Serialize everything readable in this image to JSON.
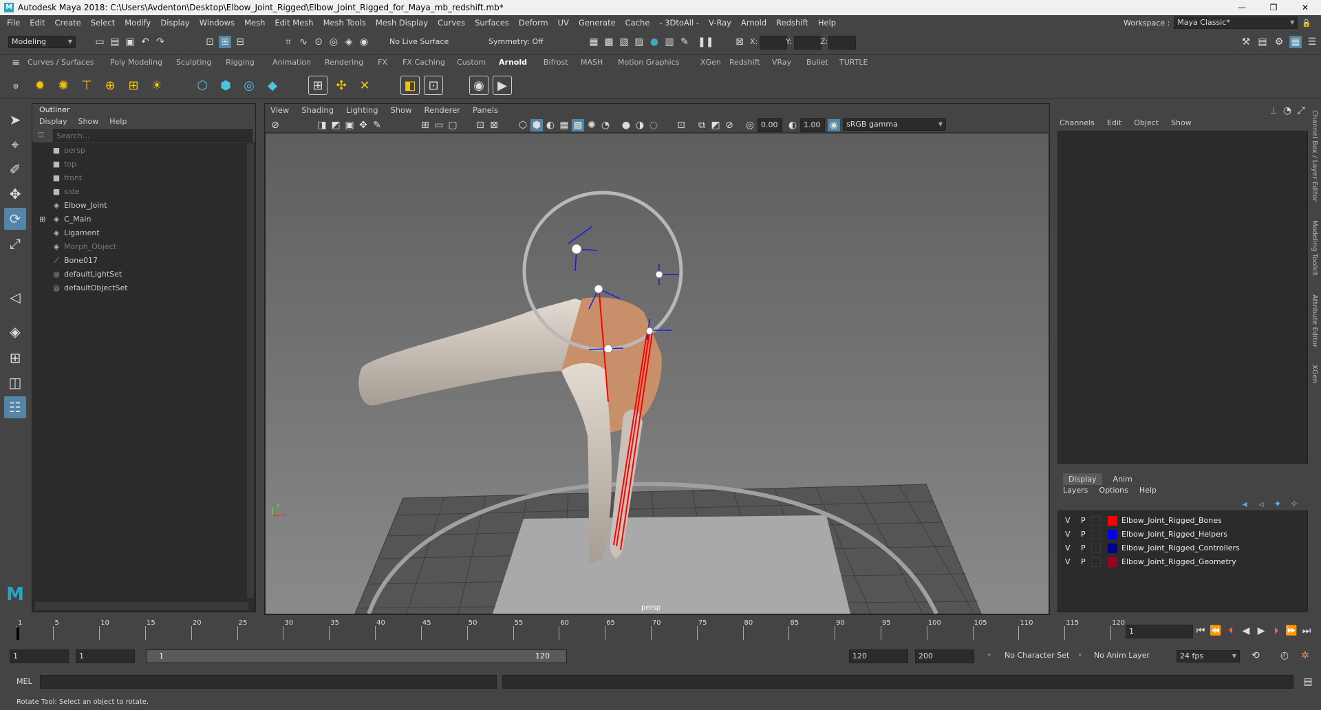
{
  "title": "Autodesk Maya 2018: C:\\Users\\Avdenton\\Desktop\\Elbow_Joint_Rigged\\Elbow_Joint_Rigged_for_Maya_mb_redshift.mb*",
  "window_buttons": [
    "—",
    "❐",
    "✕"
  ],
  "menus": [
    "File",
    "Edit",
    "Create",
    "Select",
    "Modify",
    "Display",
    "Windows",
    "Mesh",
    "Edit Mesh",
    "Mesh Tools",
    "Mesh Display",
    "Curves",
    "Surfaces",
    "Deform",
    "UV",
    "Generate",
    "Cache",
    "- 3DtoAll -",
    "V-Ray",
    "Arnold",
    "Redshift",
    "Help"
  ],
  "workspace": {
    "label": "Workspace :",
    "value": "Maya Classic*"
  },
  "status": {
    "mode": "Modeling",
    "live_surface": "No Live Surface",
    "symmetry": "Symmetry: Off",
    "x_label": "X:",
    "y_label": "Y:",
    "z_label": "Z:"
  },
  "shelf_tabs": [
    "Curves / Surfaces",
    "Poly Modeling",
    "Sculpting",
    "Rigging",
    "Animation",
    "Rendering",
    "FX",
    "FX Caching",
    "Custom",
    "Arnold",
    "Bifrost",
    "MASH",
    "Motion Graphics",
    "XGen",
    "Redshift",
    "VRay",
    "Bullet",
    "TURTLE"
  ],
  "active_shelf": "Arnold",
  "outliner": {
    "title": "Outliner",
    "menu": [
      "Display",
      "Show",
      "Help"
    ],
    "search_placeholder": "Search...",
    "items": [
      {
        "label": "persp",
        "icon": "camera-icon",
        "dim": true
      },
      {
        "label": "top",
        "icon": "camera-icon",
        "dim": true
      },
      {
        "label": "front",
        "icon": "camera-icon",
        "dim": true
      },
      {
        "label": "side",
        "icon": "camera-icon",
        "dim": true
      },
      {
        "label": "Elbow_Joint",
        "icon": "transform-icon",
        "dim": false
      },
      {
        "label": "C_Main",
        "icon": "transform-icon",
        "dim": false,
        "expandable": true
      },
      {
        "label": "Ligament",
        "icon": "transform-icon",
        "dim": false
      },
      {
        "label": "Morph_Object",
        "icon": "transform-icon",
        "dim": true
      },
      {
        "label": "Bone017",
        "icon": "joint-icon",
        "dim": false
      },
      {
        "label": "defaultLightSet",
        "icon": "set-icon",
        "dim": false
      },
      {
        "label": "defaultObjectSet",
        "icon": "set-icon",
        "dim": false
      }
    ]
  },
  "viewport": {
    "menu": [
      "View",
      "Shading",
      "Lighting",
      "Show",
      "Renderer",
      "Panels"
    ],
    "exposure": "0.00",
    "gamma": "1.00",
    "colorspace": "sRGB gamma",
    "camera_label": "persp",
    "axis_y": "y",
    "axis_x": "x"
  },
  "channel_box": {
    "menu": [
      "Channels",
      "Edit",
      "Object",
      "Show"
    ]
  },
  "layer_editor": {
    "tabs": [
      "Display",
      "Anim"
    ],
    "menu": [
      "Layers",
      "Options",
      "Help"
    ],
    "layers": [
      {
        "v": "V",
        "p": "P",
        "color": "#ff0000",
        "name": "Elbow_Joint_Rigged_Bones"
      },
      {
        "v": "V",
        "p": "P",
        "color": "#0000ff",
        "name": "Elbow_Joint_Rigged_Helpers"
      },
      {
        "v": "V",
        "p": "P",
        "color": "#00008b",
        "name": "Elbow_Joint_Rigged_Controllers"
      },
      {
        "v": "V",
        "p": "P",
        "color": "#a00020",
        "name": "Elbow_Joint_Rigged_Geometry"
      }
    ]
  },
  "side_tabs": [
    "Channel Box / Layer Editor",
    "Modeling Toolkit",
    "Attribute Editor",
    "XGen"
  ],
  "timeline": {
    "ticks": [
      "1",
      "5",
      "10",
      "15",
      "20",
      "25",
      "30",
      "35",
      "40",
      "45",
      "50",
      "55",
      "60",
      "65",
      "70",
      "75",
      "80",
      "85",
      "90",
      "95",
      "100",
      "105",
      "110",
      "115",
      "120"
    ],
    "current_frame": "1"
  },
  "range": {
    "start": "1",
    "inner_start": "1",
    "slider_start": "1",
    "slider_end": "120",
    "end": "120",
    "anim_end": "200",
    "character_set": "No Character Set",
    "anim_layer": "No Anim Layer",
    "fps": "24 fps"
  },
  "command": {
    "label": "MEL"
  },
  "help_line": "Rotate Tool: Select an object to rotate."
}
